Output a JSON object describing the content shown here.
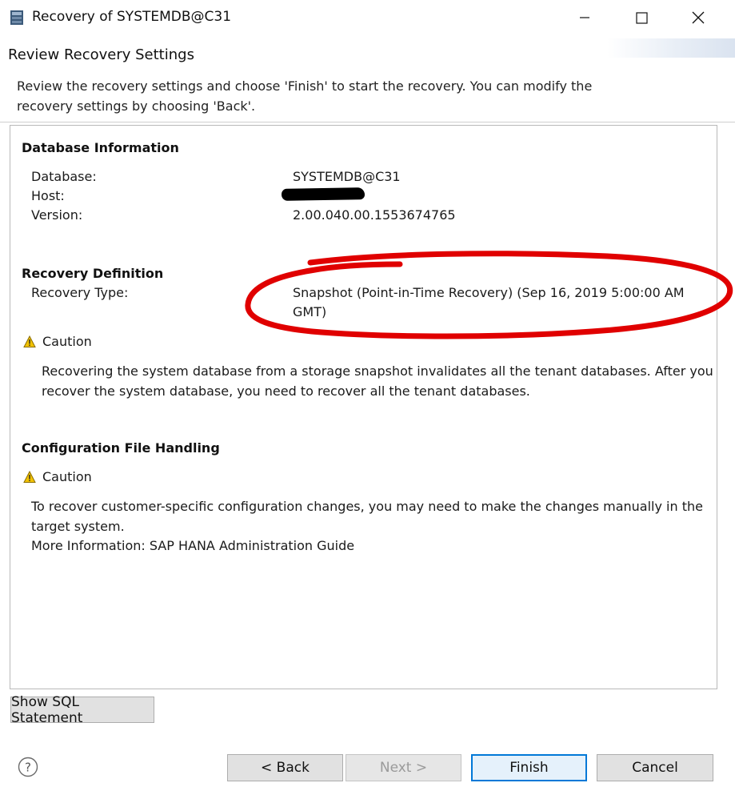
{
  "window": {
    "title": "Recovery of SYSTEMDB@C31"
  },
  "header": {
    "title": "Review Recovery Settings",
    "description": "Review the recovery settings and choose 'Finish' to start the recovery. You can modify the recovery settings by choosing 'Back'."
  },
  "database_info": {
    "heading": "Database Information",
    "database_label": "Database:",
    "database_value": "SYSTEMDB@C31",
    "host_label": "Host:",
    "version_label": "Version:",
    "version_value": "2.00.040.00.1553674765"
  },
  "recovery_definition": {
    "heading": "Recovery Definition",
    "type_label": "Recovery Type:",
    "type_value_line1": "Snapshot (Point-in-Time Recovery) (Sep 16, 2019 5:00:00 AM",
    "type_value_line2": "GMT)",
    "caution_label": "Caution",
    "caution_line1": "Recovering the system database from a storage snapshot invalidates all the tenant databases. After you",
    "caution_line2": "recover the system database, you need to recover all the tenant databases."
  },
  "config_handling": {
    "heading": "Configuration File Handling",
    "caution_label": "Caution",
    "text_line1": "To recover customer-specific configuration changes, you may need to make the changes manually in the",
    "text_line2": "target system.",
    "text_line3": "More Information: SAP HANA Administration Guide"
  },
  "buttons": {
    "show_sql": "Show SQL Statement",
    "back": "< Back",
    "next": "Next >",
    "finish": "Finish",
    "cancel": "Cancel",
    "help": "?"
  },
  "colors": {
    "annotation_red": "#e00000",
    "caution_yellow": "#f2c200",
    "primary_border": "#0078d7"
  },
  "icons": {
    "app": "app-icon",
    "minimize": "minimize-icon",
    "maximize": "maximize-icon",
    "close": "close-icon",
    "caution": "warning-icon",
    "help": "help-icon"
  }
}
